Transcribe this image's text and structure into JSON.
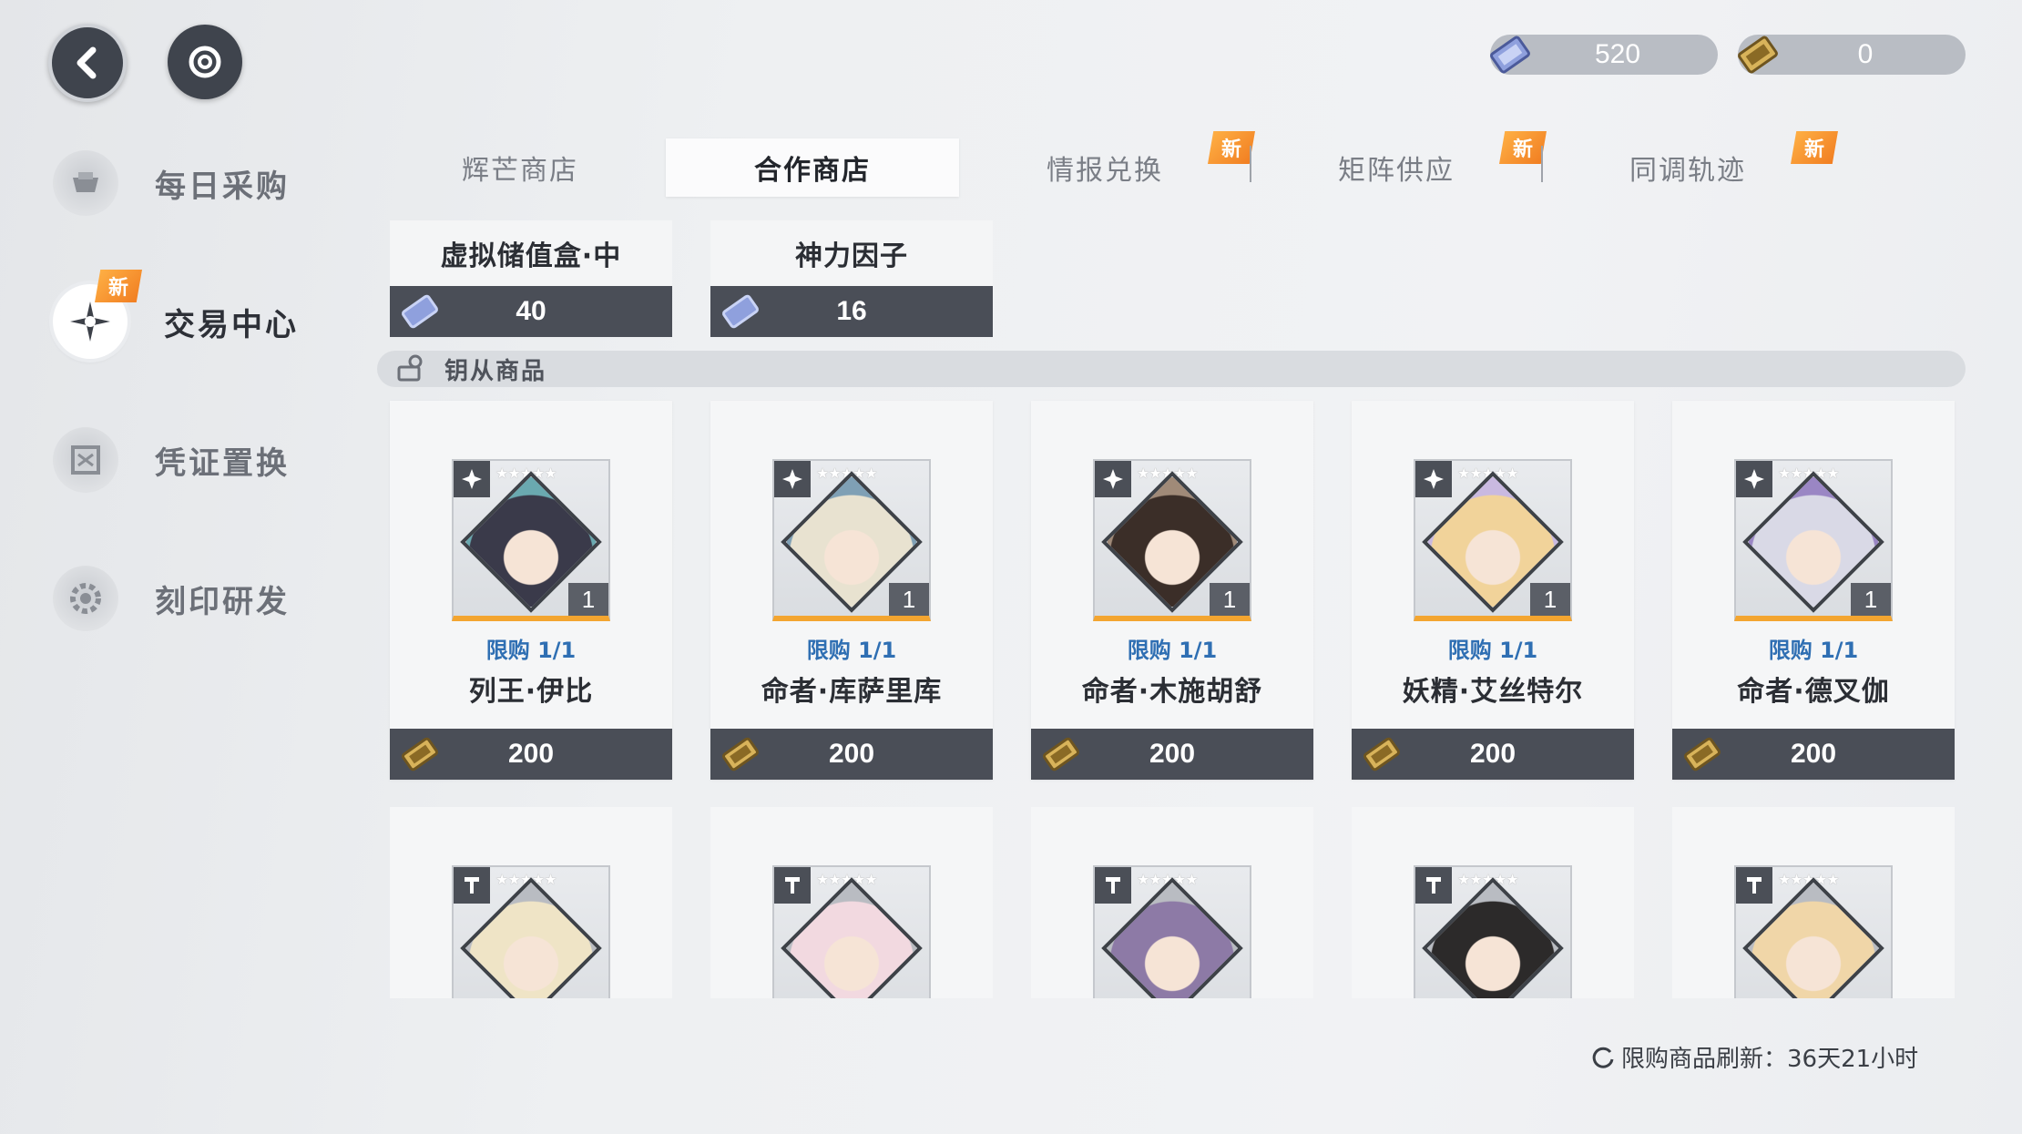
{
  "top_buttons": {
    "back": "back",
    "refresh": "refresh"
  },
  "currencies": [
    {
      "name": "crystal",
      "value": "520",
      "color": "#6b7dc4"
    },
    {
      "name": "ticket",
      "value": "0",
      "color": "#c9a44a"
    }
  ],
  "sidebar": {
    "items": [
      {
        "label": "每日采购",
        "icon": "cart-icon"
      },
      {
        "label": "交易中心",
        "icon": "compass-icon",
        "badge": "新",
        "active": true
      },
      {
        "label": "凭证置换",
        "icon": "voucher-icon"
      },
      {
        "label": "刻印研发",
        "icon": "gear-icon"
      }
    ]
  },
  "tabs": [
    {
      "label": "辉芒商店"
    },
    {
      "label": "合作商店",
      "active": true
    },
    {
      "label": "情报兑换",
      "badge": "新"
    },
    {
      "label": "矩阵供应",
      "badge": "新"
    },
    {
      "label": "同调轨迹",
      "badge": "新"
    }
  ],
  "top_items": [
    {
      "name": "虚拟储值盒·中",
      "price": "40"
    },
    {
      "name": "神力因子",
      "price": "16"
    }
  ],
  "section": {
    "title": "钥从商品"
  },
  "cards": [
    {
      "limit": "限购 1/1",
      "name": "列王·伊比",
      "price": "200",
      "qty": "1",
      "stars": "★★★★★",
      "hair": "#3a3a4a",
      "accent": "#6aa9b0"
    },
    {
      "limit": "限购 1/1",
      "name": "命者·库萨里库",
      "price": "200",
      "qty": "1",
      "stars": "★★★★★",
      "hair": "#e8e2d0",
      "accent": "#7fa0b5"
    },
    {
      "limit": "限购 1/1",
      "name": "命者·木施胡舒",
      "price": "200",
      "qty": "1",
      "stars": "★★★★★",
      "hair": "#3b2e28",
      "accent": "#a08a78"
    },
    {
      "limit": "限购 1/1",
      "name": "妖精·艾丝特尔",
      "price": "200",
      "qty": "1",
      "stars": "★★★★★",
      "hair": "#f1d39a",
      "accent": "#c9b9e0"
    },
    {
      "limit": "限购 1/1",
      "name": "命者·德叉伽",
      "price": "200",
      "qty": "1",
      "stars": "★★★★★",
      "hair": "#d9d9e6",
      "accent": "#9a86c4"
    }
  ],
  "cards_row2": [
    {
      "stars": "★★★★★",
      "hair": "#efe4c6"
    },
    {
      "stars": "★★★★★",
      "hair": "#f2d9e0"
    },
    {
      "stars": "★★★★★",
      "hair": "#8d7aa6"
    },
    {
      "stars": "★★★★★",
      "hair": "#2c2a2a"
    },
    {
      "stars": "★★★★★",
      "hair": "#f0d6a8"
    }
  ],
  "refresh_note": "限购商品刷新：36天21小时"
}
